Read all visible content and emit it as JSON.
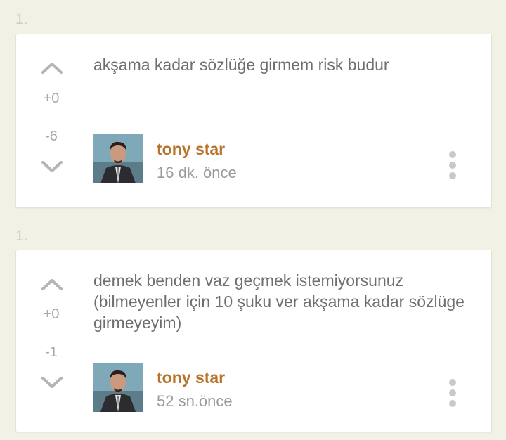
{
  "entries": [
    {
      "number": "1.",
      "text": "akşama kadar sözlüğe girmem risk budur",
      "upvotes": "+0",
      "downvotes": "-6",
      "author": "tony star",
      "time": "16 dk. önce",
      "icons": {
        "up": "chevron-up-icon",
        "down": "chevron-down-icon",
        "menu": "more-vertical-icon"
      }
    },
    {
      "number": "1.",
      "text": "demek benden vaz geçmek istemiyorsunuz (bilmeyenler için 10 şuku ver akşama kadar sözlüge girmeyeyim)",
      "upvotes": "+0",
      "downvotes": "-1",
      "author": "tony star",
      "time": "52 sn.önce",
      "icons": {
        "up": "chevron-up-icon",
        "down": "chevron-down-icon",
        "menu": "more-vertical-icon"
      }
    }
  ],
  "colors": {
    "background": "#f2f1e6",
    "card": "#ffffff",
    "author": "#b8732a",
    "text": "#6f6f6f",
    "muted": "#9a9a9a"
  }
}
